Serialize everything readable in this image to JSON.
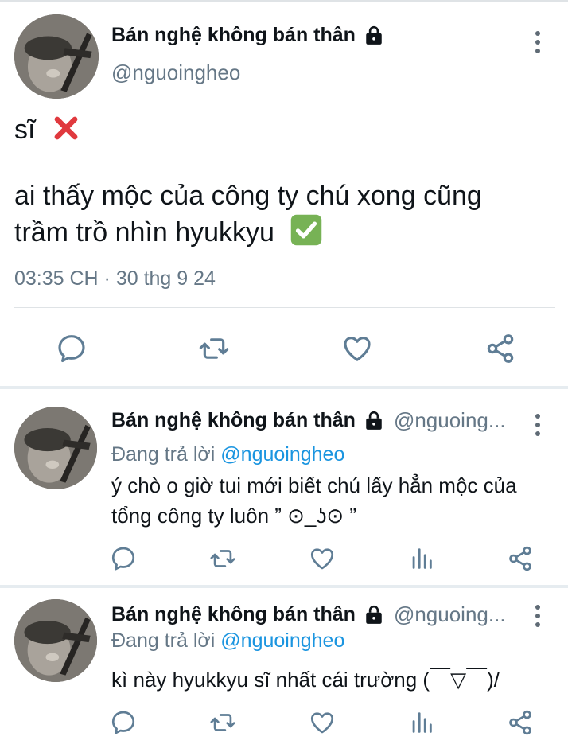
{
  "colors": {
    "text": "#0f1419",
    "secondary": "#657786",
    "link": "#1b95e0",
    "divider": "#e6ecf0",
    "icon": "#5f7d95"
  },
  "main_tweet": {
    "author": {
      "display_name": "Bán nghệ không bán thân",
      "handle": "@nguoingheo",
      "protected_icon": "lock-icon"
    },
    "text_lines": [
      "sĩ",
      "ai thấy mộc của công ty chú xong cũng",
      "trầm trồ nhìn hyukkyu"
    ],
    "emojis": [
      "cross-mark-emoji",
      "check-mark-emoji"
    ],
    "timestamp": "03:35 CH · 30 thg 9 24",
    "actions": [
      "reply-icon",
      "retweet-icon",
      "like-icon",
      "share-icon"
    ]
  },
  "replies": [
    {
      "author": {
        "display_name": "Bán nghệ không bán thân",
        "handle": "@nguoing..."
      },
      "replying_prefix": "Đang trả lời",
      "replying_to": "@nguoingheo",
      "text_lines": [
        "ý chò o giờ tui mới biết chú lấy hẳn mộc của",
        "tổng công ty luôn ” ⊙_ʖ⊙ ”"
      ],
      "actions": [
        "reply-icon",
        "retweet-icon",
        "like-icon",
        "analytics-icon",
        "share-icon"
      ]
    },
    {
      "author": {
        "display_name": "Bán nghệ không bán thân",
        "handle": "@nguoing..."
      },
      "replying_prefix": "Đang trả lời",
      "replying_to": "@nguoingheo",
      "text_lines": [
        "kì này hyukkyu sĩ nhất cái trường (￣▽￣)/"
      ],
      "actions": [
        "reply-icon",
        "retweet-icon",
        "like-icon",
        "analytics-icon",
        "share-icon"
      ]
    }
  ]
}
